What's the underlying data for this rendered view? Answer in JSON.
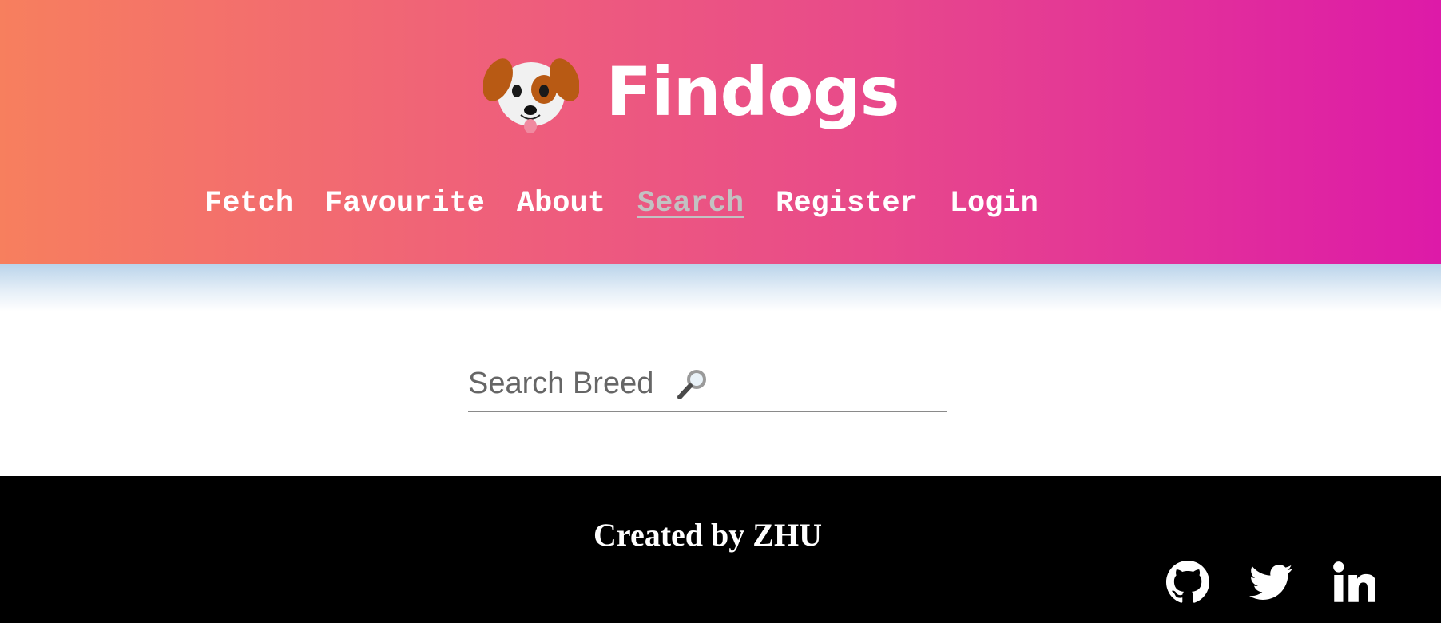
{
  "header": {
    "brand_icon": "dog-face-icon",
    "title": "Findogs"
  },
  "nav": {
    "items": [
      {
        "label": "Fetch",
        "active": false
      },
      {
        "label": "Favourite",
        "active": false
      },
      {
        "label": "About",
        "active": false
      },
      {
        "label": "Search",
        "active": true
      },
      {
        "label": "Register",
        "active": false
      },
      {
        "label": "Login",
        "active": false
      }
    ]
  },
  "search": {
    "placeholder": "Search Breed",
    "icon": "magnifier-icon",
    "value": ""
  },
  "footer": {
    "credit": "Created by ZHU",
    "social": [
      "github-icon",
      "twitter-icon",
      "linkedin-icon"
    ]
  },
  "colors": {
    "header_gradient_start": "#f77f5e",
    "header_gradient_end": "#dd1aa8",
    "nav_active": "#c2c2c2",
    "footer_bg": "#000000"
  }
}
